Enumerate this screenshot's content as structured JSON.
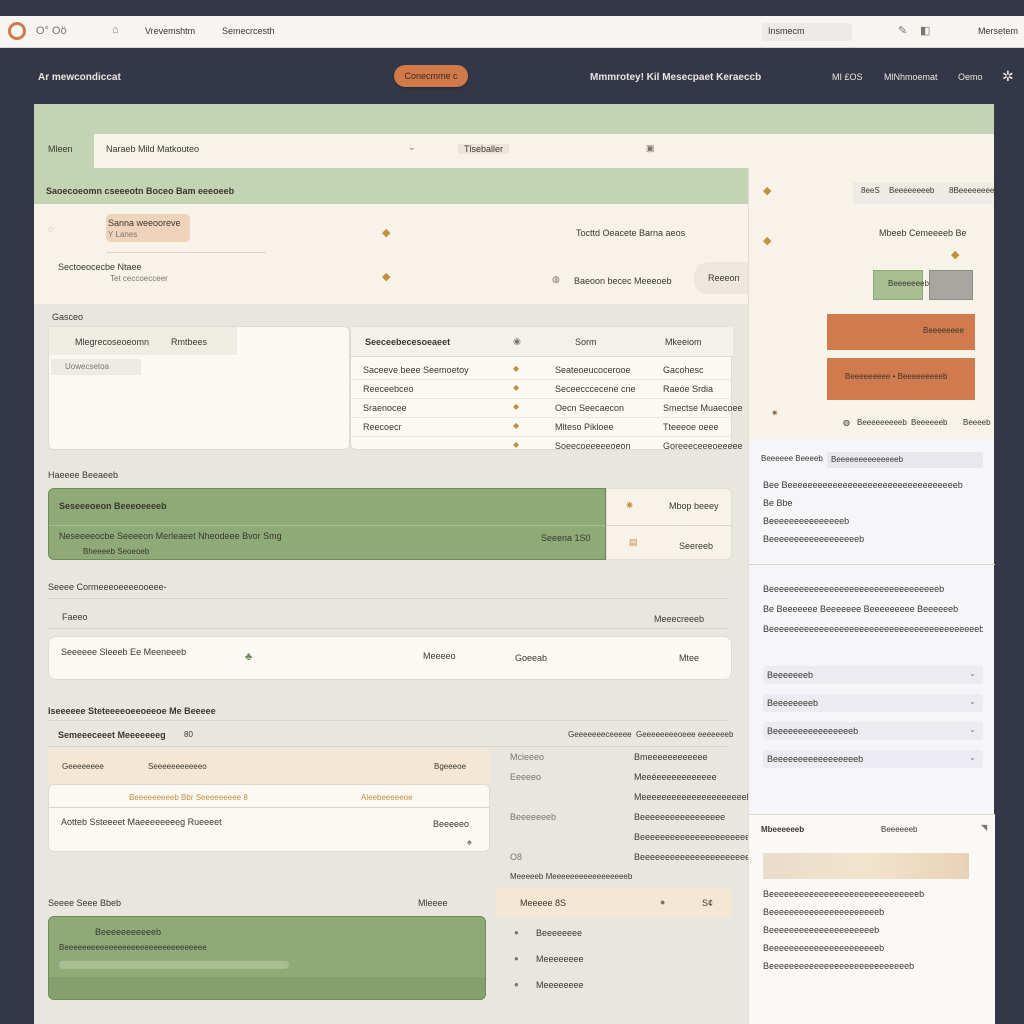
{
  "browser": {
    "tab_label": "Vrevemshtm",
    "tab2_label": "Semecrcesth",
    "address_text": "Insmecm",
    "right_label": "Mersetem",
    "left_glyph": "O° Oö"
  },
  "header": {
    "app_title": "Ar mewcondiccat",
    "pill_label": "Conecmme c",
    "center_title": "Mmmrotey! Kil Mesecpaet Keraeccb",
    "nav": [
      "MI £OS",
      "MlNhmoemat",
      "Oemo"
    ]
  },
  "filter": {
    "label": "Mleen",
    "query": "Naraeb Mild Matkouteo",
    "tag": "Tlseballer"
  },
  "section1": {
    "title": "Saoecoeomn cseeeotn Boceo Bam eeeoeeb",
    "row1_title": "Sanna weeooreve",
    "row1_sub": "Y Lanes",
    "row1_right": "Tocttd Oeacete Barna aeos",
    "row2_title": "Sectoeocecbe Ntaee",
    "row2_sub": "Tet ceccoecceer",
    "row2_right": "Baeoon becec Meeeoeb",
    "row2_btn": "Reeeon"
  },
  "section2": {
    "label": "Gasceo",
    "left_headers": [
      "Mlegrecoseoeomn",
      "Rmtbees"
    ],
    "left_value": "Uowecsetoa",
    "table_headers": [
      "Seeceebecesoeaeet",
      "Sorm",
      "Mkeeiom"
    ],
    "rows": [
      [
        "Saceeve beee Seemoetoy",
        "Seateoeucocerooe",
        "Gacohesc"
      ],
      [
        "Reeceebceo",
        "Seceecccecene cne",
        "Raeoe Srdia"
      ],
      [
        "Sraenocee",
        "Oecn Seecaecon",
        "Smectse Muaecoee"
      ],
      [
        "Reecoecr",
        "Mlteso Pikloee",
        "Tteeeoe oeee"
      ],
      [
        "",
        "Soeecoeeeeeoeon",
        "Goreeeceeeoeeeee"
      ]
    ]
  },
  "section3": {
    "label": "Haeeee Beeaeeb",
    "title": "Seseeeoeon Beeeoeeeeb",
    "line1": "Neseeeeocbe Seeeeon Merleaeet Nheodeee Bvor Smg",
    "line1_value": "Seeena 1S0",
    "line2": "Bheeeeb Seoeoeb",
    "right_top": "Mbop beeey",
    "right_bottom": "Seereeb"
  },
  "section4": {
    "label": "Seeee Cormeeeoeeeeooeee-",
    "sub_left": "Faeeo",
    "sub_right": "Meeecreeeb",
    "field1": "Seeeeee Sleeeb Ee Meeneeeb",
    "field2": "Meeeeo",
    "field3": "Goeeab",
    "field4": "Mtee"
  },
  "section5": {
    "label": "Iseeeeee Steteeeeoeeoeeoe Me Beeeee",
    "sub_title": "Semeeeceeet Meeeeeeeg",
    "sub_count": "80",
    "right_head1": "Geeeeeeeceeeee",
    "right_head2": "Geeeeeeeeoeee eeeeeeeb",
    "col_a": "Geeeeeeee",
    "col_b": "Seeeeeeeeeeeo",
    "col_c": "Bgeeeoe",
    "row_a": "Beeeeeeeeeb Bbr Seeeeeeeee 8",
    "row_a2": "Aleebeeeeeoe",
    "row_b": "Aotteb Ssteeeet Maeeeeeeeeg Rueeeet",
    "row_b2": "Beeeeeo",
    "right_rows": [
      [
        "Mcieeeo",
        "Bmeeeeeeeeeeee"
      ],
      [
        "Eeeeeo",
        "Meeéeeeeeeeeeeee"
      ],
      [
        "",
        "Meeeeeeeeeeeeeeeeeeeeeb"
      ],
      [
        "Beeeeeeeb",
        "Beeeeeeeeeeeeeeeee"
      ],
      [
        "",
        "Beeeeeeeeeeeeeeeeeeeeeeeeeeeo"
      ],
      [
        "O8",
        "Beeeeeeeeeeeeeeeeeeeeeeeeeeeeeeeee"
      ]
    ]
  },
  "section6": {
    "label": "Seeee Seee Bbeb",
    "label_right": "Mleeee",
    "card_title": "Beeeeeeeeeeeb",
    "card_line1": "Beeeeeeeeeeeeeeeeeeeeeeeeeeeeeeee",
    "right_head": "Meeeeeb Meeeeeeeeeeeeeeeeeb",
    "right_card": "Meeeee 8S",
    "right_card_val": "S¢",
    "list": [
      "Beeeeeeee",
      "Meeeeeeee",
      "Meeeeeeee"
    ]
  },
  "sidebar": {
    "top_tabs": [
      "8eeS",
      "Beeeeeeeeb",
      "8Beeeeeeeeb"
    ],
    "title": "Mbeeb Cemeeeeb Be",
    "btn_a": "Beeeeeeee",
    "btn_b": "Beeeeeeeee • Beeeeeeeeeb",
    "footer": [
      "Beeeeeeeeeb",
      "Beeeeeeb",
      "Beeeeb"
    ],
    "search_label": "Beeeeee Beeeeb",
    "search_value": "Beeeeeeeeeeeeeeb",
    "info_lines": [
      "Bee Beeeeeeeeeeeeeeeeeeeeeeeeeeeeeeeeeeb",
      "Be Bbe",
      "Beeeeeeeeeeeeeeeb",
      "Beeeeeeeeeeeeeeeeeeb"
    ],
    "mid_lines": [
      "Beeeeeeeeeeeeeeeeeeeeeeeeeeeeeeeeeeb",
      "Be Beeeeeee Beeeeeee Beeeeeeeee Beeeeeeb",
      "Beeeeeeeeeeeeeeeeeeeeeeeeeeeeeeeeeeeeeeeeeeb"
    ],
    "fields": [
      "Beeeeeeeb",
      "Beeeeeeeeb",
      "Beeeeeeeeeeeeeeeeb",
      "Beeeeeeeeeeeeeeeeeb"
    ],
    "bottom_title": "Mbeeeeeeb",
    "bottom_sub": "Beeeeeeb",
    "bottom_lines": [
      "Beeeeeeeeeeeeeeeeeeeeeeeeeeeeeeb",
      "Beeeeeeeeeeeeeeeeeeeeeeb",
      "Beeeeeeeeeeeeeeeeeeeeeb",
      "Beeeeeeeeeeeeeeeeeeeeeeb",
      "Beeeeeeeeeeeeeeeeeeeeeeeeeeeeb"
    ]
  },
  "colors": {
    "accent": "#cf7b4d",
    "sage": "#8eaa76",
    "band": "#c4d3b2",
    "cream": "#f7f3e8",
    "navy": "#343748"
  }
}
